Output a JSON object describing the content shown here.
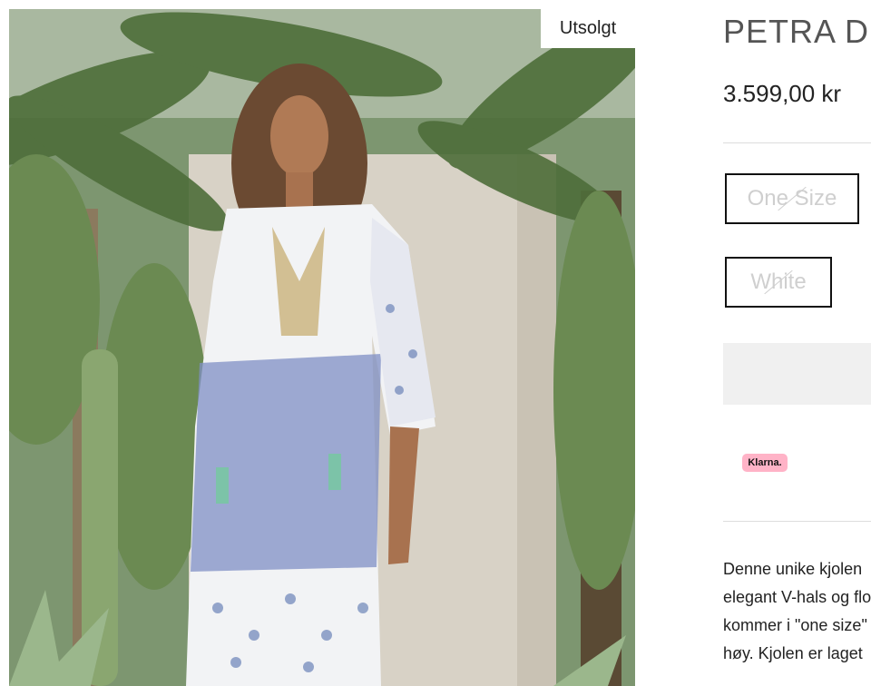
{
  "product": {
    "title": "PETRA DR",
    "price": "3.599,00 kr",
    "badge": "Utsolgt",
    "image_alt": "Woman in white and blue paisley maxi dress among palm trees"
  },
  "options": {
    "size": "One Size",
    "color": "White"
  },
  "payment": {
    "klarna_label": "Klarna."
  },
  "description": {
    "lines": [
      "Denne unike kjolen",
      "elegant V-hals og flo",
      "kommer i \"one size\"",
      "høy. Kjolen er laget"
    ]
  },
  "colors": {
    "klarna_pink": "#ffb3c7",
    "sold_out_text": "#cfcfcf",
    "cart_button_bg": "#f0f0f0"
  }
}
